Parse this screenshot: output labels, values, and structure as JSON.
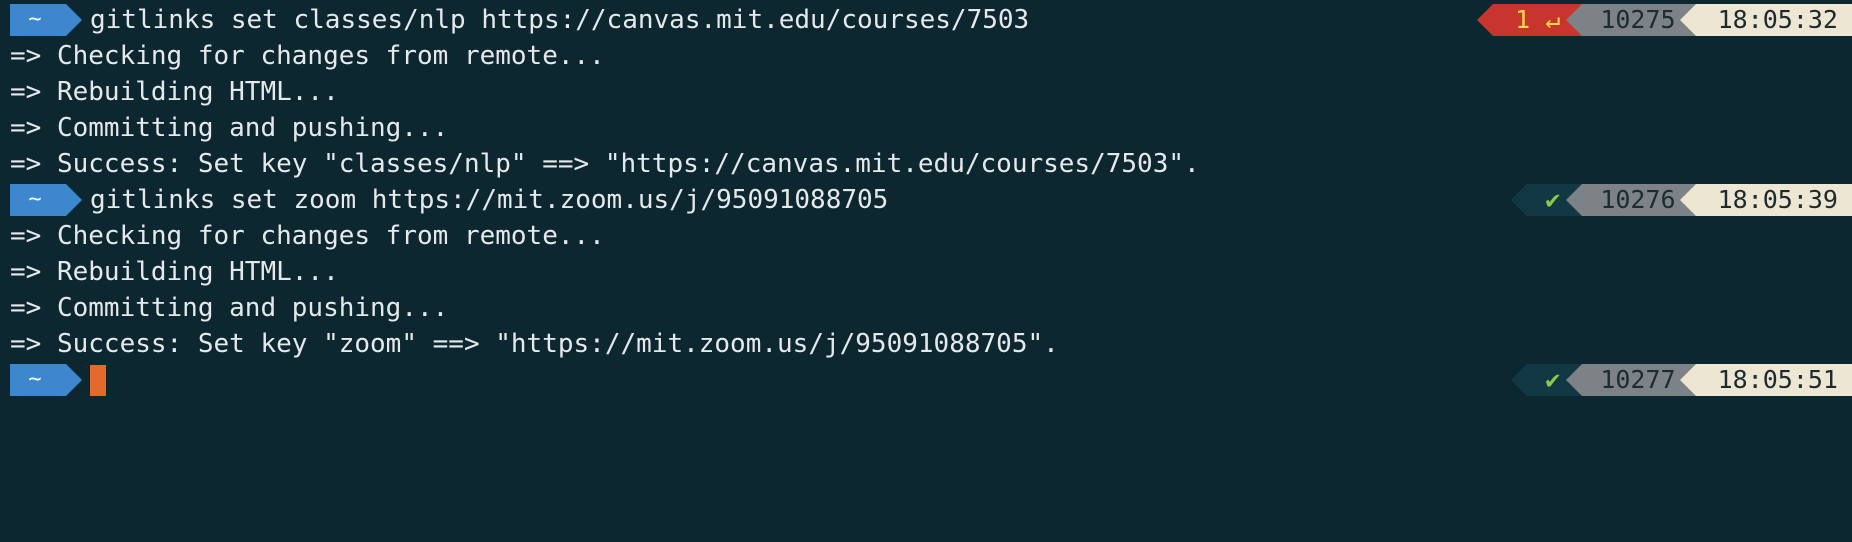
{
  "prompt": {
    "dir_symbol": "~"
  },
  "blocks": [
    {
      "command": "gitlinks set classes/nlp https://canvas.mit.edu/courses/7503",
      "status": "1 ↵",
      "history": "10275",
      "time": "18:05:32",
      "output": [
        "=> Checking for changes from remote...",
        "=> Rebuilding HTML...",
        "=> Committing and pushing...",
        "=> Success: Set key \"classes/nlp\" ==> \"https://canvas.mit.edu/courses/7503\"."
      ]
    },
    {
      "command": "gitlinks set zoom https://mit.zoom.us/j/95091088705",
      "status": "✔",
      "history": "10276",
      "time": "18:05:39",
      "output": [
        "=> Checking for changes from remote...",
        "=> Rebuilding HTML...",
        "=> Committing and pushing...",
        "=> Success: Set key \"zoom\" ==> \"https://mit.zoom.us/j/95091088705\"."
      ]
    }
  ],
  "current": {
    "status": "✔",
    "history": "10277",
    "time": "18:05:51"
  },
  "colors": {
    "background": "#0d2731",
    "dir_segment": "#3d87cf",
    "error_segment": "#c8342e",
    "ok_segment": "#123843",
    "history_segment": "#7d8286",
    "time_segment": "#ece6d3",
    "cursor": "#e5692a"
  }
}
